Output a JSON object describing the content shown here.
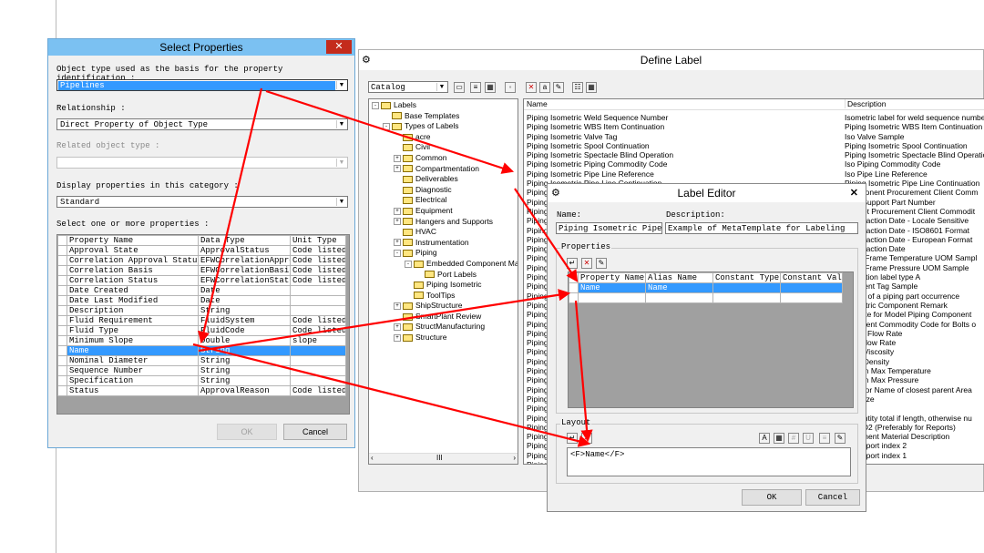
{
  "select_properties": {
    "title": "Select Properties",
    "object_type_label": "Object type used as the basis for the property identification :",
    "object_type_value": "Pipelines",
    "relationship_label": "Relationship :",
    "relationship_value": "Direct Property of Object Type",
    "related_object_label": "Related object type :",
    "display_category_label": "Display properties in this category :",
    "display_category_value": "Standard",
    "select_props_label": "Select one or more properties :",
    "columns": [
      "Property Name",
      "Data Type",
      "Unit Type"
    ],
    "rows": [
      [
        "Approval State",
        "ApprovalStatus",
        "Code listed"
      ],
      [
        "Correlation Approval Status",
        "EFWCorrelationApproval",
        "Code listed"
      ],
      [
        "Correlation Basis",
        "EFWCorrelationBasis",
        "Code listed"
      ],
      [
        "Correlation Status",
        "EFWCorrelationStatus",
        "Code listed"
      ],
      [
        "Date Created",
        "Date",
        ""
      ],
      [
        "Date Last Modified",
        "Date",
        ""
      ],
      [
        "Description",
        "String",
        ""
      ],
      [
        "Fluid Requirement",
        "FluidSystem",
        "Code listed"
      ],
      [
        "Fluid Type",
        "FluidCode",
        "Code listed"
      ],
      [
        "Minimum Slope",
        "Double",
        "slope"
      ],
      [
        "Name",
        "String",
        ""
      ],
      [
        "Nominal Diameter",
        "String",
        ""
      ],
      [
        "Sequence Number",
        "String",
        ""
      ],
      [
        "Specification",
        "String",
        ""
      ],
      [
        "Status",
        "ApprovalReason",
        "Code listed"
      ]
    ],
    "ok_label": "OK",
    "cancel_label": "Cancel"
  },
  "define_label": {
    "title": "Define Label",
    "catalog_value": "Catalog",
    "tree": [
      {
        "text": "Labels",
        "level": 0,
        "exp": "-"
      },
      {
        "text": "Base Templates",
        "level": 1,
        "exp": ""
      },
      {
        "text": "Types of Labels",
        "level": 1,
        "exp": "-"
      },
      {
        "text": "acre",
        "level": 2,
        "exp": ""
      },
      {
        "text": "Civil",
        "level": 2,
        "exp": ""
      },
      {
        "text": "Common",
        "level": 2,
        "exp": "+"
      },
      {
        "text": "Compartmentation",
        "level": 2,
        "exp": "+"
      },
      {
        "text": "Deliverables",
        "level": 2,
        "exp": ""
      },
      {
        "text": "Diagnostic",
        "level": 2,
        "exp": ""
      },
      {
        "text": "Electrical",
        "level": 2,
        "exp": ""
      },
      {
        "text": "Equipment",
        "level": 2,
        "exp": "+"
      },
      {
        "text": "Hangers and Supports",
        "level": 2,
        "exp": "+"
      },
      {
        "text": "HVAC",
        "level": 2,
        "exp": ""
      },
      {
        "text": "Instrumentation",
        "level": 2,
        "exp": "+"
      },
      {
        "text": "Piping",
        "level": 2,
        "exp": "-"
      },
      {
        "text": "Embedded Component Mat",
        "level": 3,
        "exp": "-"
      },
      {
        "text": "Port Labels",
        "level": 4,
        "exp": ""
      },
      {
        "text": "Piping Isometric",
        "level": 3,
        "exp": ""
      },
      {
        "text": "ToolTips",
        "level": 3,
        "exp": ""
      },
      {
        "text": "ShipStructure",
        "level": 2,
        "exp": "+"
      },
      {
        "text": "SmartPlant Review",
        "level": 2,
        "exp": ""
      },
      {
        "text": "StructManufacturing",
        "level": 2,
        "exp": "+"
      },
      {
        "text": "Structure",
        "level": 2,
        "exp": "+"
      }
    ],
    "list_header_name": "Name",
    "list_header_desc": "Description",
    "names": [
      "Piping Isometric Weld Sequence Number",
      "Piping Isometric WBS Item Continuation",
      "Piping Isometric Valve Tag",
      "Piping Isometric Spool Continuation",
      "Piping Isometric Spectacle Blind Operation",
      "Piping Isometric Piping Commodity Code",
      "Piping Isometric Pipe Line Reference",
      "Piping Isometric Pipe Line Continuation",
      "Piping",
      "Piping",
      "Piping",
      "Piping",
      "Piping",
      "Piping",
      "Piping",
      "Piping",
      "Piping",
      "Piping",
      "Piping",
      "Piping",
      "Piping",
      "Piping",
      "Piping",
      "Piping",
      "Piping",
      "Piping",
      "Piping",
      "Piping",
      "Piping",
      "Piping",
      "Piping",
      "Piping",
      "Piping",
      "Piping",
      "Piping",
      "Piping",
      "Piping",
      "Piping",
      "Pipe P",
      "Pipe P"
    ],
    "descs": [
      "Isometric label for weld sequence number",
      "Piping Isometric WBS Item Continuation",
      "Iso Valve Sample",
      "Piping Isometric Spool Continuation",
      "Piping Isometric Spectacle Blind Operation",
      "Iso Piping Commodity Code",
      "Iso Pipe Line Reference",
      "Piping Isometric Pipe Line Continuation",
      "Component Procurement Client Comm",
      "nger Support Part Number",
      "Gasket Procurement Client Commodit",
      "ic Extraction Date - Locale Sensitive",
      "ic Extraction Date - ISO8601 Format",
      "ic Extraction Date - European Format",
      "ic Extraction Date",
      "awingFrame Temperature UOM Sampl",
      "awingFrame Pressure UOM Sample",
      "ntinuation label type A",
      "mponent Tag Sample",
      "ace Id of a piping part occurrence",
      "Isometric Component Remark",
      "ec Note for Model Piping Component",
      "ependent Commodity Code for Bolts o",
      "Liquid Flow Rate",
      "Gas Flow Rate",
      "Fluid Viscosity",
      "Fluid Density",
      "Design Max Temperature",
      "Design Max Pressure",
      "label for Name of closest parent Area",
      "lary Size",
      "Size",
      "y quantity total if length, otherwise nu",
      "& NPD2 (Preferably for Reports)",
      "omponent Material Description",
      "r pipe port index 2",
      "r pipe port index 1"
    ]
  },
  "label_editor": {
    "title": "Label Editor",
    "name_label": "Name:",
    "name_value": "Piping Isometric Pipe Lin",
    "desc_label": "Description:",
    "desc_value": "Example of MetaTemplate for Labeling",
    "properties_label": "Properties",
    "prop_columns": [
      "Property Name",
      "Alias Name",
      "Constant Type",
      "Constant Value"
    ],
    "prop_row": [
      "Name",
      "Name",
      "",
      ""
    ],
    "layout_label": "Layout",
    "layout_text": "<F>Name</F>",
    "ok_label": "OK",
    "cancel_label": "Cancel"
  },
  "colors": {
    "selection": "#3399ff",
    "annotation_arrow": "#ff0000",
    "title_bar": "#7bc1f2",
    "close_button": "#c42b1c"
  }
}
